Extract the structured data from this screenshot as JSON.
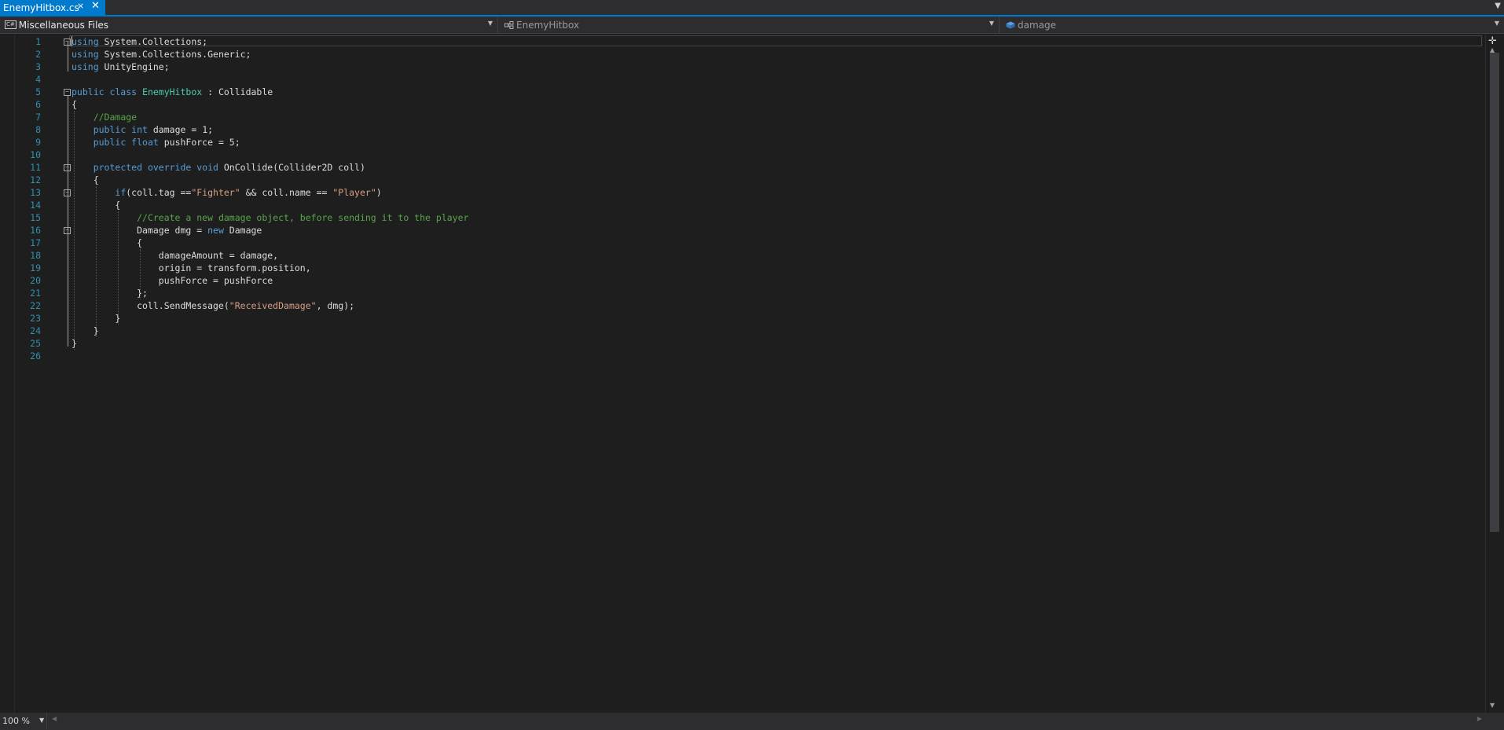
{
  "tab": {
    "title": "EnemyHitbox.cs",
    "pin_icon": "pin-icon",
    "close_icon": "close-icon"
  },
  "navbar": {
    "project": "Miscellaneous Files",
    "type": "EnemyHitbox",
    "member": "damage"
  },
  "editor": {
    "lines": [
      {
        "n": "1",
        "tokens": [
          {
            "t": "using",
            "c": "kw"
          },
          {
            "t": " System.Collections;",
            "c": ""
          }
        ]
      },
      {
        "n": "2",
        "tokens": [
          {
            "t": "using",
            "c": "kw"
          },
          {
            "t": " System.Collections.Generic;",
            "c": ""
          }
        ]
      },
      {
        "n": "3",
        "tokens": [
          {
            "t": "using",
            "c": "kw"
          },
          {
            "t": " UnityEngine;",
            "c": ""
          }
        ]
      },
      {
        "n": "4",
        "tokens": []
      },
      {
        "n": "5",
        "tokens": [
          {
            "t": "public class ",
            "c": "kw"
          },
          {
            "t": "EnemyHitbox",
            "c": "ty"
          },
          {
            "t": " : Collidable",
            "c": ""
          }
        ]
      },
      {
        "n": "6",
        "tokens": [
          {
            "t": "{",
            "c": ""
          }
        ]
      },
      {
        "n": "7",
        "tokens": [
          {
            "t": "    ",
            "c": ""
          },
          {
            "t": "//Damage",
            "c": "cm"
          }
        ]
      },
      {
        "n": "8",
        "tokens": [
          {
            "t": "    ",
            "c": ""
          },
          {
            "t": "public int",
            "c": "kw"
          },
          {
            "t": " damage = 1;",
            "c": ""
          }
        ]
      },
      {
        "n": "9",
        "tokens": [
          {
            "t": "    ",
            "c": ""
          },
          {
            "t": "public float",
            "c": "kw"
          },
          {
            "t": " pushForce = 5;",
            "c": ""
          }
        ]
      },
      {
        "n": "10",
        "tokens": []
      },
      {
        "n": "11",
        "tokens": [
          {
            "t": "    ",
            "c": ""
          },
          {
            "t": "protected override void",
            "c": "kw"
          },
          {
            "t": " OnCollide(Collider2D coll)",
            "c": ""
          }
        ]
      },
      {
        "n": "12",
        "tokens": [
          {
            "t": "    {",
            "c": ""
          }
        ]
      },
      {
        "n": "13",
        "tokens": [
          {
            "t": "        ",
            "c": ""
          },
          {
            "t": "if",
            "c": "kw"
          },
          {
            "t": "(coll.tag ==",
            "c": ""
          },
          {
            "t": "\"Fighter\"",
            "c": "st"
          },
          {
            "t": " && coll.name == ",
            "c": ""
          },
          {
            "t": "\"Player\"",
            "c": "st"
          },
          {
            "t": ")",
            "c": ""
          }
        ]
      },
      {
        "n": "14",
        "tokens": [
          {
            "t": "        {",
            "c": ""
          }
        ]
      },
      {
        "n": "15",
        "tokens": [
          {
            "t": "            ",
            "c": ""
          },
          {
            "t": "//Create a new damage object, before sending it to the player",
            "c": "cm"
          }
        ]
      },
      {
        "n": "16",
        "tokens": [
          {
            "t": "            Damage dmg = ",
            "c": ""
          },
          {
            "t": "new",
            "c": "kw"
          },
          {
            "t": " Damage",
            "c": ""
          }
        ]
      },
      {
        "n": "17",
        "tokens": [
          {
            "t": "            {",
            "c": ""
          }
        ]
      },
      {
        "n": "18",
        "tokens": [
          {
            "t": "                damageAmount = damage,",
            "c": ""
          }
        ]
      },
      {
        "n": "19",
        "tokens": [
          {
            "t": "                origin = transform.position,",
            "c": ""
          }
        ]
      },
      {
        "n": "20",
        "tokens": [
          {
            "t": "                pushForce = pushForce",
            "c": ""
          }
        ]
      },
      {
        "n": "21",
        "tokens": [
          {
            "t": "            };",
            "c": ""
          }
        ]
      },
      {
        "n": "22",
        "tokens": [
          {
            "t": "            coll.SendMessage(",
            "c": ""
          },
          {
            "t": "\"ReceivedDamage\"",
            "c": "st"
          },
          {
            "t": ", dmg);",
            "c": ""
          }
        ]
      },
      {
        "n": "23",
        "tokens": [
          {
            "t": "        }",
            "c": ""
          }
        ]
      },
      {
        "n": "24",
        "tokens": [
          {
            "t": "    }",
            "c": ""
          }
        ]
      },
      {
        "n": "25",
        "tokens": [
          {
            "t": "}",
            "c": ""
          }
        ]
      },
      {
        "n": "26",
        "tokens": []
      }
    ],
    "fold_lines": [
      "1",
      "5",
      "11",
      "13",
      "16"
    ]
  },
  "status": {
    "zoom": "100 %"
  },
  "colors": {
    "accent": "#007acc",
    "keyword": "#569cd6",
    "type": "#4ec9b0",
    "comment": "#57a64a",
    "string": "#d69d85",
    "line_number": "#2b91af"
  }
}
